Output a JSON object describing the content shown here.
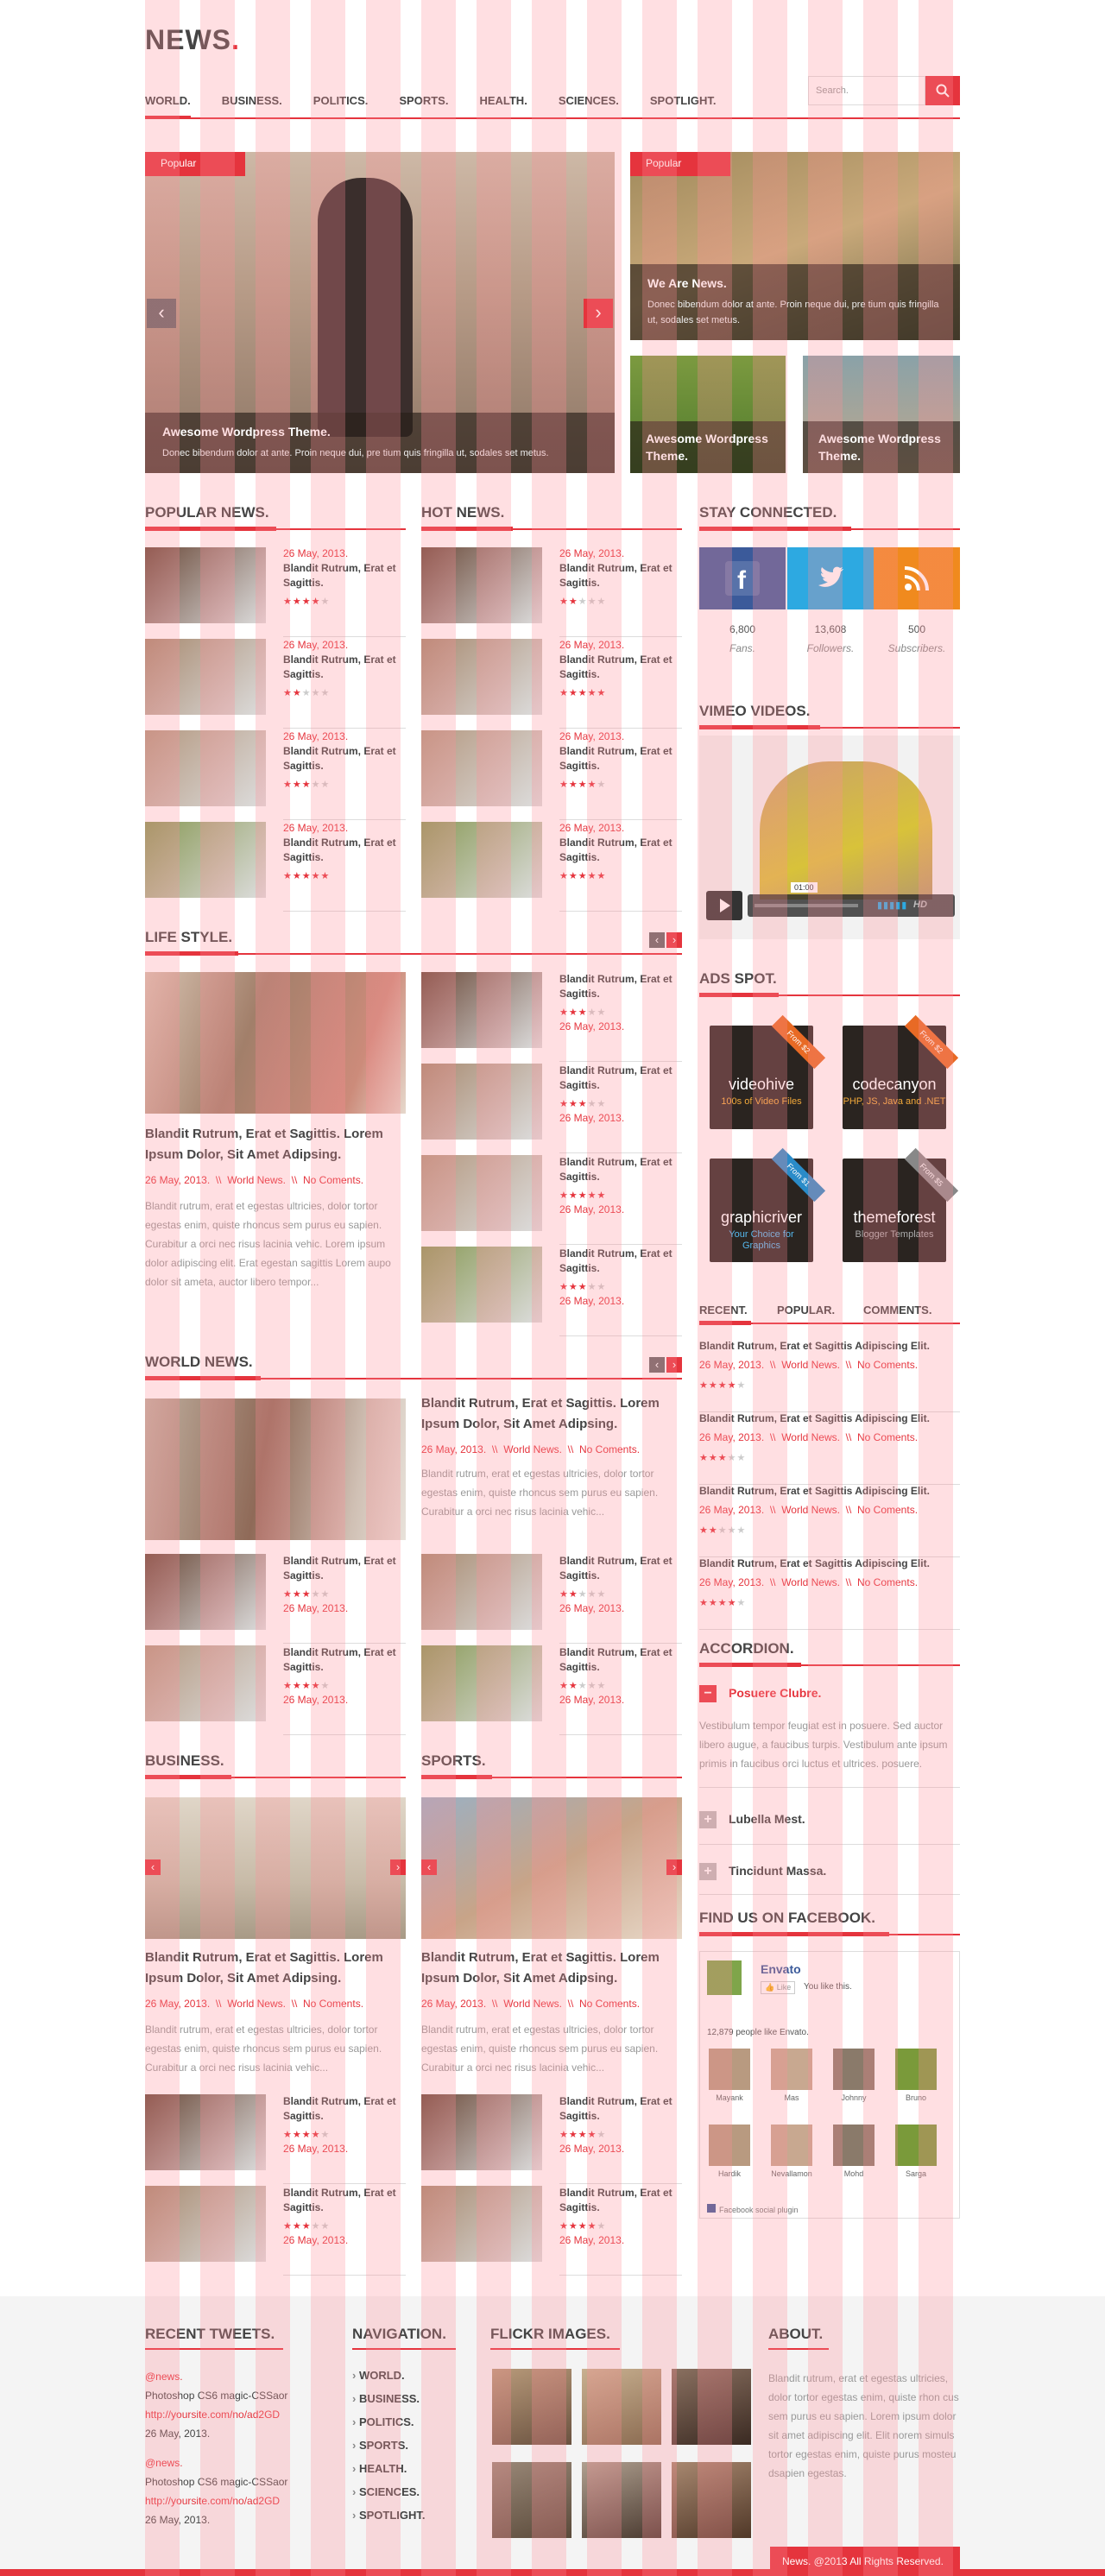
{
  "site": {
    "logo": "NEWS",
    "logo_dot": ".",
    "search_placeholder": "Search."
  },
  "nav": [
    "WORLD.",
    "BUSINESS.",
    "POLITICS.",
    "SPORTS.",
    "HEALTH.",
    "SCIENCES.",
    "SPOTLIGHT."
  ],
  "slider": {
    "tag": "Popular",
    "main_title": "Awesome Wordpress Theme.",
    "main_text": "Donec bibendum dolor at ante. Proin neque dui, pre tium quis fringilla ut,  sodales set metus.",
    "side_tag": "Popular",
    "side_title": "We Are News.",
    "side_text": "Donec bibendum dolor at ante. Proin neque dui, pre tium quis fringilla ut, sodales set metus.",
    "small1": "Awesome Wordpress Theme.",
    "small2": "Awesome Wordpress Theme."
  },
  "sections": {
    "popular": "POPULAR NEWS.",
    "hot": "HOT NEWS.",
    "stay": "STAY CONNECTED.",
    "vimeo": "VIMEO VIDEOS.",
    "life": "LIFE STYLE.",
    "ads": "ADS SPOT.",
    "world": "WORLD NEWS.",
    "business": "BUSINESS.",
    "sports": "SPORTS.",
    "accordion": "ACCORDION.",
    "facebook": "FIND US ON FACEBOOK."
  },
  "item": {
    "date": "26 May, 2013.",
    "title": "Blandit Rutrum, Erat et Sagittis."
  },
  "ratings": {
    "popular": [
      4,
      2,
      3,
      5
    ],
    "hot": [
      2,
      5,
      4,
      5
    ],
    "life": [
      3,
      3,
      5,
      3
    ],
    "world": [
      3,
      2,
      4,
      2
    ],
    "business": [
      4,
      3
    ],
    "sports": [
      4,
      4
    ]
  },
  "post": {
    "title": "Blandit Rutrum, Erat et Sagittis. Lorem Ipsum Dolor, Sit Amet Adipsing.",
    "date": "26 May, 2013.",
    "sep": "\\\\",
    "cat": "World News.",
    "comments": "No Coments.",
    "body": "Blandit rutrum, erat et egestas ultricies, dolor tortor egestas enim, quiste rhoncus sem purus eu sapien. Curabitur a orci nec risus lacinia vehic. Lorem ipsum dolor adipiscing elit. Erat egestan sagittis Lorem aupo dolor sit ameta, auctor libero tempor...",
    "body_short": "Blandit rutrum, erat et egestas ultricies, dolor tortor egestas enim, quiste rhoncus sem purus eu sapien. Curabitur a orci nec risus lacinia vehic..."
  },
  "social": [
    {
      "count": "6,800",
      "label": "Fans.",
      "color": "#3b5a9a",
      "icon": "facebook-icon"
    },
    {
      "count": "13,608",
      "label": "Followers.",
      "color": "#2da9e1",
      "icon": "twitter-icon"
    },
    {
      "count": "500",
      "label": "Subscribers.",
      "color": "#f08a1e",
      "icon": "rss-icon"
    }
  ],
  "video": {
    "time": "01:00",
    "hd": "HD"
  },
  "ads": [
    {
      "name": "videohive",
      "sub": "100s of Video Files",
      "badge": "From $2"
    },
    {
      "name": "codecanyon",
      "sub": "PHP, JS, Java and .NET",
      "badge": "From $2"
    },
    {
      "name": "graphicriver",
      "sub": "Your Choice for Graphics",
      "badge": "From $1"
    },
    {
      "name": "themeforest",
      "sub": "Blogger Templates",
      "badge": "From $5"
    }
  ],
  "tabs": [
    "RECENT.",
    "POPULAR.",
    "COMMENTS."
  ],
  "recent": {
    "title": "Blandit Rutrum, Erat et Sagittis Adipiscing Elit.",
    "ratings": [
      4,
      3,
      2,
      4
    ]
  },
  "accordion": {
    "open_title": "Posuere Clubre.",
    "open_text": "Vestibulum tempor feugiat est in posuere. Sed auctor libero augue, a faucibus turpis. Vestibulum ante ipsum primis in faucibus orci luctus et ultrices. posuere.",
    "item2": "Lubella Mest.",
    "item3": "Tincidunt Massa."
  },
  "fb": {
    "page": "Envato",
    "like": "Like",
    "you_like": "You like this.",
    "people": "12,879 people like Envato.",
    "names": [
      "Mayank",
      "Mas",
      "Johnny",
      "Bruno",
      "Hardik",
      "Nevallamon",
      "Mohd",
      "Sarga"
    ],
    "plugin": "Facebook social plugin"
  },
  "footer": {
    "tweets_title": "RECENT TWEETS.",
    "nav_title": "NAVIGATION.",
    "flickr_title": "FLICKR IMAGES.",
    "about_title": "ABOUT.",
    "tweet": {
      "handle": "@news.",
      "text": "Photoshop CS6 magic-CSSaor",
      "link": "http://yoursite.com/no/ad2GD",
      "date": "26 May, 2013."
    },
    "nav": [
      "WORLD.",
      "BUSINESS.",
      "POLITICS.",
      "SPORTS.",
      "HEALTH.",
      "SCIENCES.",
      "SPOTLIGHT."
    ],
    "about": "Blandit rutrum, erat et egestas ultricies, dolor tortor egestas enim, quiste rhon cus sem purus eu sapien. Lorem ipsum dolor sit amet adipiscing elit. Elit norem simuls tortor egestas enim, quiste purus mosteu dsapien egestas.",
    "copyright": "News. @2013 All Rights Reserved."
  }
}
